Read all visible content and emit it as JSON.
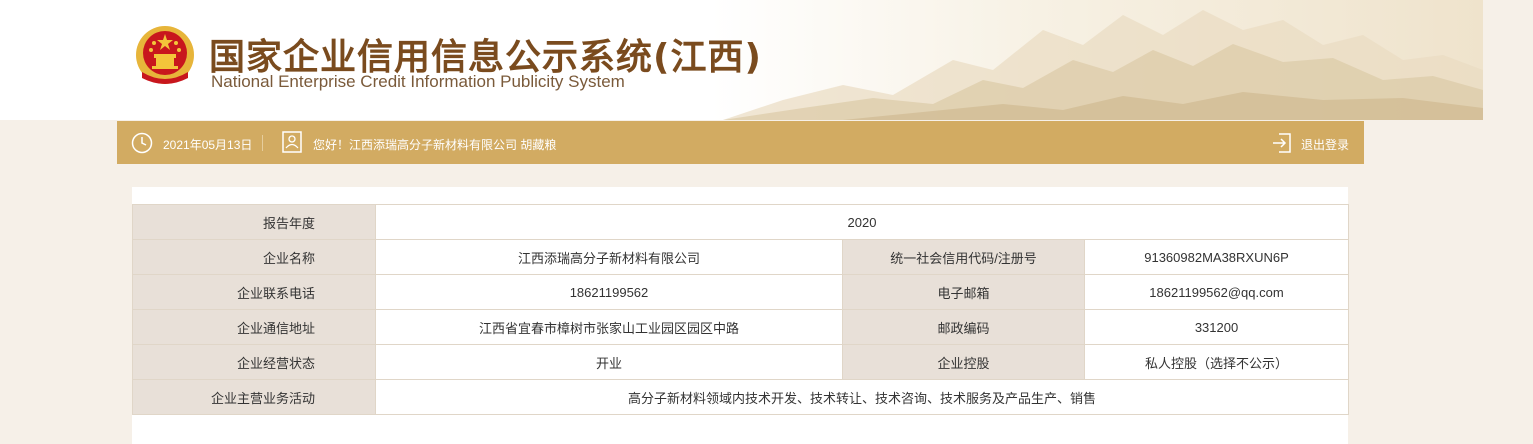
{
  "header": {
    "title_cn": "国家企业信用信息公示系统(江西)",
    "title_en": "National Enterprise Credit Information Publicity System"
  },
  "topbar": {
    "date": "2021年05月13日",
    "greeting": "您好！江西添瑞高分子新材料有限公司   胡藏粮",
    "logout": "退出登录"
  },
  "table": {
    "report_year_label": "报告年度",
    "report_year": "2020",
    "company_name_label": "企业名称",
    "company_name": "江西添瑞高分子新材料有限公司",
    "credit_code_label": "统一社会信用代码/注册号",
    "credit_code": "91360982MA38RXUN6P",
    "phone_label": "企业联系电话",
    "phone": "18621199562",
    "email_label": "电子邮箱",
    "email": "18621199562@qq.com",
    "address_label": "企业通信地址",
    "address": "江西省宜春市樟树市张家山工业园区园区中路",
    "postcode_label": "邮政编码",
    "postcode": "331200",
    "status_label": "企业经营状态",
    "status": "开业",
    "holding_label": "企业控股",
    "holding": "私人控股（选择不公示）",
    "business_label": "企业主营业务活动",
    "business": "高分子新材料领域内技术开发、技术转让、技术咨询、技术服务及产品生产、销售"
  },
  "colors": {
    "topbar": "#d2ab62",
    "label_bg": "#e8e0d8",
    "title": "#7a4b1e",
    "emblem_red": "#c8161d",
    "emblem_gold": "#e7b53a"
  },
  "icons": [
    "national-emblem-icon",
    "clock-icon",
    "user-icon",
    "logout-icon"
  ]
}
